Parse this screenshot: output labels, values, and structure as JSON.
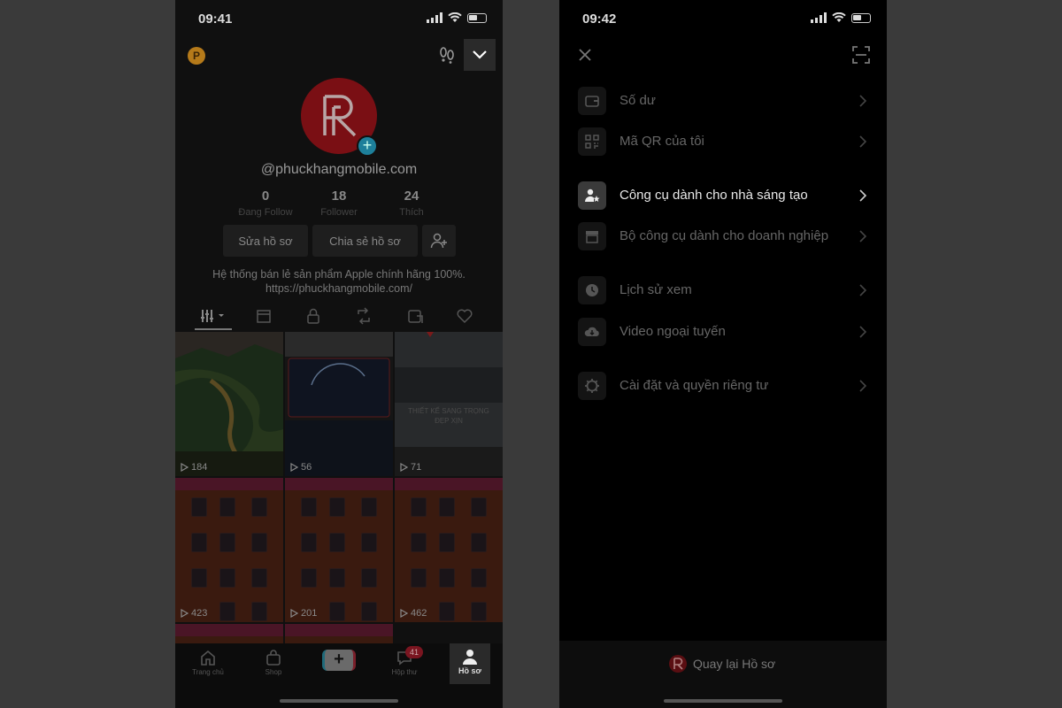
{
  "left": {
    "status_time": "09:41",
    "coin_letter": "P",
    "username": "@phuckhangmobile.com",
    "stats": [
      {
        "num": "0",
        "label": "Đang Follow"
      },
      {
        "num": "18",
        "label": "Follower"
      },
      {
        "num": "24",
        "label": "Thích"
      }
    ],
    "edit_button": "Sửa hồ sơ",
    "share_button": "Chia sẻ hồ sơ",
    "bio_line1": "Hệ thống bán lẻ sản phẩm Apple chính hãng 100%.",
    "bio_line2": "https://phuckhangmobile.com/",
    "videos": [
      {
        "views": "184"
      },
      {
        "views": "56"
      },
      {
        "views": "71"
      },
      {
        "views": "423"
      },
      {
        "views": "201"
      },
      {
        "views": "462"
      }
    ],
    "video3_overlay": "THIẾT KẾ SANG TRỌNG\nĐẸP XỊN",
    "tabbar": {
      "home": "Trang chủ",
      "shop": "Shop",
      "plus": "+",
      "inbox": "Hộp thư",
      "inbox_badge": "41",
      "profile": "Hồ sơ"
    }
  },
  "right": {
    "status_time": "09:42",
    "menu": [
      {
        "label": "Số dư",
        "icon": "wallet-icon"
      },
      {
        "label": "Mã QR của tôi",
        "icon": "qr-code-icon"
      },
      {
        "label": "Công cụ dành cho nhà sáng tạo",
        "icon": "creator-star-icon"
      },
      {
        "label": "Bộ công cụ dành cho doanh nghiệp",
        "icon": "store-icon"
      },
      {
        "label": "Lịch sử xem",
        "icon": "clock-icon"
      },
      {
        "label": "Video ngoại tuyến",
        "icon": "cloud-download-icon"
      },
      {
        "label": "Cài đặt và quyền riêng tư",
        "icon": "settings-gear-icon"
      }
    ],
    "active_menu_item": "Công cụ dành cho nhà sáng tạo",
    "back_to_profile": "Quay lại Hồ sơ"
  },
  "colors": {
    "backdrop": "#3a3a3a",
    "avatar_red": "#7a0f14",
    "active_text": "#e8e8e8"
  }
}
